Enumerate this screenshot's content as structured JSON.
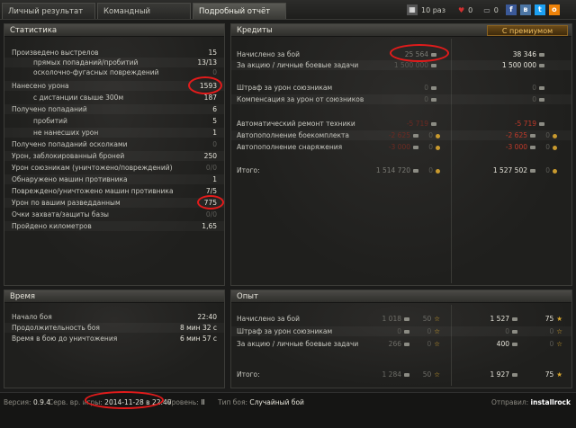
{
  "tabs": [
    {
      "label": "Личный результат"
    },
    {
      "label": "Командный результат"
    },
    {
      "label": "Подробный отчёт"
    }
  ],
  "share": {
    "views": "10 раз",
    "likes": "0",
    "comments": "0"
  },
  "stats": {
    "title": "Статистика",
    "rows": [
      {
        "label": "Произведено выстрелов",
        "value": "15"
      },
      {
        "label": "прямых попаданий/пробитий",
        "value": "13/13"
      },
      {
        "label": "осколочно-фугасных повреждений",
        "value": "0"
      },
      {
        "label": "Нанесено урона",
        "value": "1593"
      },
      {
        "label": "с дистанции свыше 300м",
        "value": "187"
      },
      {
        "label": "Получено попаданий",
        "value": "6"
      },
      {
        "label": "пробитий",
        "value": "5"
      },
      {
        "label": "не нанесших урон",
        "value": "1"
      },
      {
        "label": "Получено попаданий осколками",
        "value": "0"
      },
      {
        "label": "Урон, заблокированный броней",
        "value": "250"
      },
      {
        "label": "Урон союзникам (уничтожено/повреждений)",
        "value": "0/0"
      },
      {
        "label": "Обнаружено машин противника",
        "value": "1"
      },
      {
        "label": "Повреждено/уничтожено машин противника",
        "value": "7/5"
      },
      {
        "label": "Урон по вашим разведданным",
        "value": "775"
      },
      {
        "label": "Очки захвата/защиты базы",
        "value": "0/0"
      },
      {
        "label": "Пройдено километров",
        "value": "1,65"
      }
    ]
  },
  "credits": {
    "title": "Кредиты",
    "premium_label": "С премиумом",
    "rows": [
      {
        "label": "Начислено за бой",
        "base": "25 564",
        "prem": "38 346"
      },
      {
        "label": "За акцию / личные боевые задачи",
        "base": "1 500 000",
        "prem": "1 500 000"
      },
      {
        "label": "Штраф за урон союзникам",
        "base": "0",
        "prem": "0"
      },
      {
        "label": "Компенсация за урон от союзников",
        "base": "0",
        "prem": "0"
      },
      {
        "label": "Автоматический ремонт техники",
        "base": "-5 719",
        "prem": "-5 719"
      },
      {
        "label": "Автопополнение боекомплекта",
        "base": "-2 625",
        "base_gold": "0",
        "prem": "-2 625",
        "prem_gold": "0"
      },
      {
        "label": "Автопополнение снаряжения",
        "base": "-3 000",
        "base_gold": "0",
        "prem": "-3 000",
        "prem_gold": "0"
      },
      {
        "label": "Итого:",
        "base": "1 514 720",
        "base_gold": "0",
        "prem": "1 527 502",
        "prem_gold": "0"
      }
    ]
  },
  "time": {
    "title": "Время",
    "rows": [
      {
        "label": "Начало боя",
        "value": "22:40"
      },
      {
        "label": "Продолжительность боя",
        "value": "8 мин 32 с"
      },
      {
        "label": "Время в бою до уничтожения",
        "value": "6 мин 57 с"
      }
    ]
  },
  "exp": {
    "title": "Опыт",
    "rows": [
      {
        "label": "Начислено за бой",
        "base": "1 018",
        "base_free": "50",
        "prem": "1 527",
        "prem_free": "75"
      },
      {
        "label": "Штраф за урон союзникам",
        "base": "0",
        "base_free": "0",
        "prem": "0",
        "prem_free": "0"
      },
      {
        "label": "За акцию / личные боевые задачи",
        "base": "266",
        "base_free": "0",
        "prem": "400",
        "prem_free": "0"
      },
      {
        "label": "Итого:",
        "base": "1 284",
        "base_free": "50",
        "prem": "1 927",
        "prem_free": "75"
      }
    ]
  },
  "footer": {
    "version_label": "Версия:",
    "version": "0.9.4",
    "server_label": "Серв. вр. игры:",
    "server_time": "2014-11-28 в 22:40",
    "level_label": "Уровень:",
    "level": "II",
    "type_label": "Тип боя:",
    "type": "Случайный бой",
    "sender_label": "Отправил:",
    "sender": "installrock"
  },
  "colors": {
    "highlight_ring": "#e21b1b",
    "premium_gold": "#f0c060",
    "negative": "#c23a2a"
  }
}
